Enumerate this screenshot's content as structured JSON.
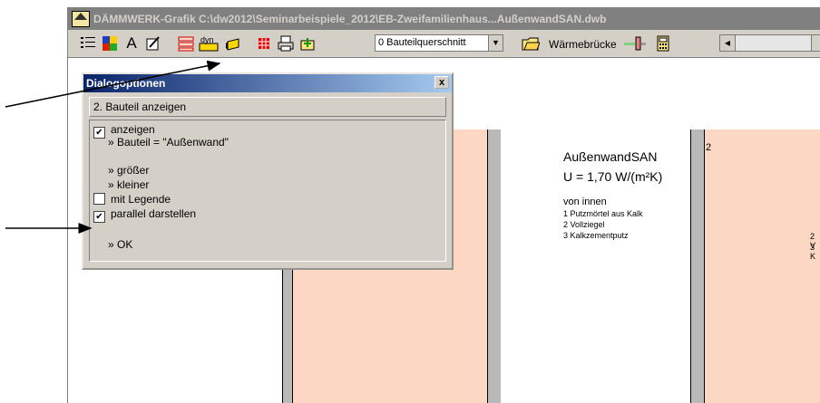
{
  "window": {
    "title": "DÄMMWERK-Grafik  C:\\dw2012\\Seminarbeispiele_2012\\EB-Zweifamilienhaus...AußenwandSAN.dwb"
  },
  "toolbar": {
    "icons": [
      "list-icon",
      "color-palette-icon",
      "text-icon",
      "edit-icon",
      "layers-icon",
      "dyn-icon",
      "block-icon",
      "grid-icon",
      "print-icon",
      "export-icon"
    ],
    "text_icon_glyph": "A",
    "dyn_label": "dyn",
    "combo_value": "0 Bauteilquerschnitt",
    "waermebruecke_label": "Wärmebrücke"
  },
  "drawing": {
    "name": "AußenwandSAN",
    "u_value": "U = 1,70 W/(m²K)",
    "direction": "von innen",
    "layers": [
      "1 Putzmörtel aus Kalk",
      "2 Vollziegel",
      "3 Kalkzementputz"
    ],
    "right_panel_number": "2",
    "right_labels": [
      "2 V",
      "3 K"
    ]
  },
  "dialog": {
    "title": "Dialogoptionen",
    "close_label": "x",
    "heading": "2. Bauteil anzeigen",
    "items": [
      {
        "type": "checkbox",
        "checked": true,
        "mark": "✔",
        "label": "anzeigen"
      },
      {
        "type": "info",
        "label": "» Bauteil = \"Außenwand\""
      },
      {
        "type": "link",
        "label": "» größer"
      },
      {
        "type": "link",
        "label": "» kleiner"
      },
      {
        "type": "checkbox",
        "checked": false,
        "mark": "",
        "label": "mit Legende"
      },
      {
        "type": "checkbox",
        "checked": true,
        "mark": "✔",
        "label": "parallel darstellen"
      },
      {
        "type": "link",
        "label": "» OK"
      }
    ]
  },
  "colors": {
    "title_bar": "#808080",
    "dialog_title_start": "#0a246a",
    "dialog_title_end": "#a6caf0",
    "wall_fill": "#fcd8c4",
    "plaster_fill": "#b9b9b9",
    "face": "#d4d0c8"
  }
}
